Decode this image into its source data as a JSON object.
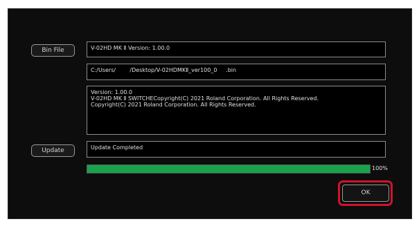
{
  "buttons": {
    "bin_file": "Bin File",
    "update": "Update",
    "ok": "OK"
  },
  "fields": {
    "version": "V-02HD MK Ⅱ Version: 1.00.0",
    "path": "C:/Users/        /Desktop/V-02HDMKⅡ_ver100_0     .bin",
    "info": "Version: 1.00.0\nV-02HD MK Ⅱ SWITCHECopyright(C) 2021 Roland Corporation. All Rights Reserved.\nCopyright(C) 2021 Roland Corporation. All Rights Reserved.",
    "status": "Update Completed"
  },
  "progress": {
    "value": 100,
    "label": "100%"
  },
  "colors": {
    "progress_fill": "#16a34a",
    "highlight": "#d1132a",
    "background": "#0d0d0d"
  }
}
